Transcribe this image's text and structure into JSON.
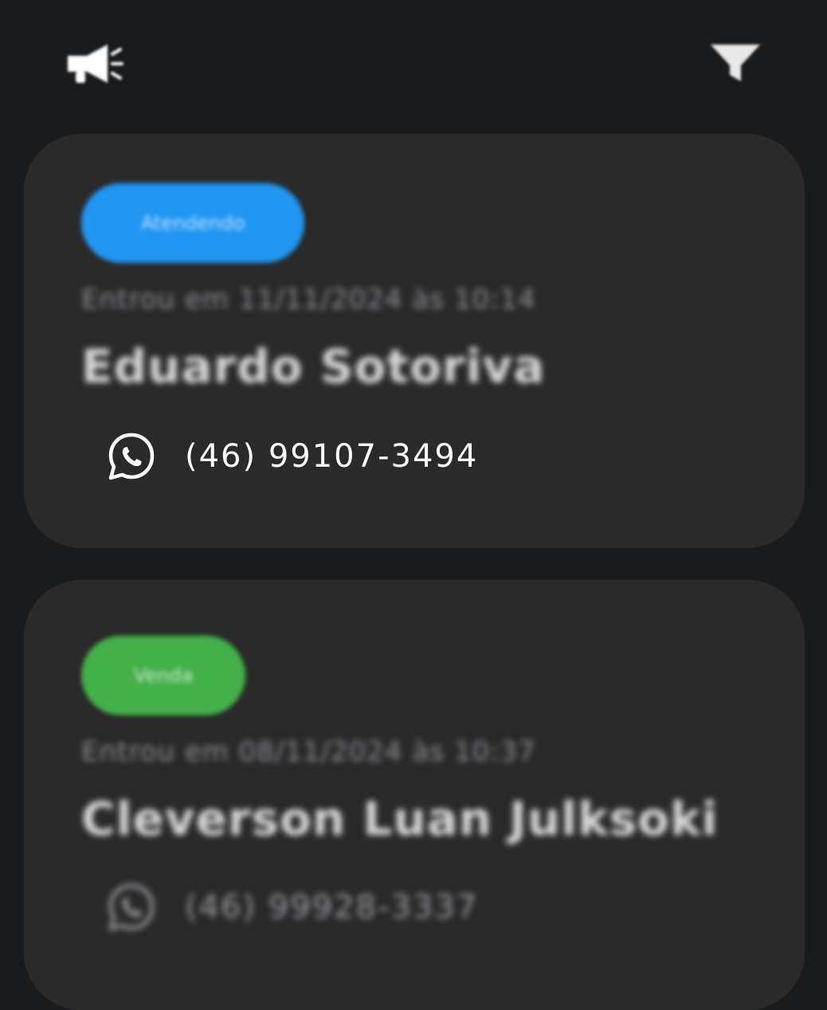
{
  "header": {
    "left_icon": "megaphone-icon",
    "right_icon": "filter-icon"
  },
  "leads": [
    {
      "status": "Atendendo",
      "status_color": "#2196f3",
      "entry": "Entrou em 11/11/2024 às 10:14",
      "name": "Eduardo Sotoriva",
      "phone": "(46) 99107-3494",
      "phone_icon": "whatsapp-icon"
    },
    {
      "status": "Venda",
      "status_color": "#43b049",
      "entry": "Entrou em 08/11/2024 às 10:37",
      "name": "Cleverson Luan Julksoki",
      "phone": "(46) 99928-3337",
      "phone_icon": "whatsapp-icon"
    }
  ]
}
